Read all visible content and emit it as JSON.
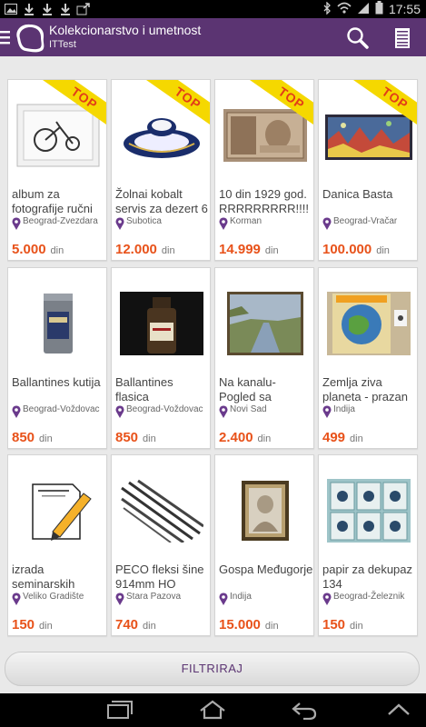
{
  "status_bar": {
    "time": "17:55",
    "left_icons": [
      "image-icon",
      "download-icon",
      "download-icon",
      "download-icon",
      "download-update-icon"
    ],
    "right_icons": [
      "bluetooth-icon",
      "wifi-icon",
      "signal-icon",
      "battery-icon"
    ]
  },
  "app_bar": {
    "title": "Kolekcionarstvo i umetnost",
    "subtitle": "ITTest",
    "background": "#5b3472"
  },
  "products": [
    {
      "title": "album za fotografije ručni",
      "location": "Beograd-Zvezdara",
      "price": "5.000",
      "currency": "din",
      "top": true,
      "badge": "TOP",
      "image": "bicycle-frame"
    },
    {
      "title": "Žolnai kobalt servis za dezert 6",
      "location": "Subotica",
      "price": "12.000",
      "currency": "din",
      "top": true,
      "badge": "TOP",
      "image": "blue-plate"
    },
    {
      "title": "10 din 1929 god. RRRRRRRRR!!!!",
      "location": "Korman",
      "price": "14.999",
      "currency": "din",
      "top": true,
      "badge": "TOP",
      "image": "banknote"
    },
    {
      "title": "Danica Basta",
      "location": "Beograd-Vračar",
      "price": "100.000",
      "currency": "din",
      "top": true,
      "badge": "TOP",
      "image": "painting"
    },
    {
      "title": "Ballantines kutija",
      "location": "Beograd-Voždovac",
      "price": "850",
      "currency": "din",
      "top": false,
      "image": "tin-box"
    },
    {
      "title": "Ballantines flasica",
      "location": "Beograd-Voždovac",
      "price": "850",
      "currency": "din",
      "top": false,
      "image": "bottle"
    },
    {
      "title": "Na kanalu- Pogled sa",
      "location": "Novi Sad",
      "price": "2.400",
      "currency": "din",
      "top": false,
      "image": "canal-painting"
    },
    {
      "title": "Zemlja ziva planeta - prazan",
      "location": "Indija",
      "price": "499",
      "currency": "din",
      "top": false,
      "image": "album-globe"
    },
    {
      "title": "izrada seminarskih",
      "location": "Veliko Gradište",
      "price": "150",
      "currency": "din",
      "top": false,
      "image": "document-pencil"
    },
    {
      "title": "PECO fleksi šine 914mm HO",
      "location": "Stara Pazova",
      "price": "740",
      "currency": "din",
      "top": false,
      "image": "rails"
    },
    {
      "title": "Gospa Međugorje",
      "location": "Indija",
      "price": "15.000",
      "currency": "din",
      "top": false,
      "image": "icon-frame"
    },
    {
      "title": "papir za dekupaz 134",
      "location": "Beograd-Železnik",
      "price": "150",
      "currency": "din",
      "top": false,
      "image": "decoupage"
    }
  ],
  "filter": {
    "label": "FILTRIRAJ"
  },
  "nav_bar": {
    "buttons": [
      "recent-apps-icon",
      "home-icon",
      "back-icon",
      "up-chevron-icon"
    ]
  },
  "colors": {
    "accent": "#5b3472",
    "price": "#e8521a",
    "badge": "#f5d800",
    "badge_text": "#e23d18"
  }
}
